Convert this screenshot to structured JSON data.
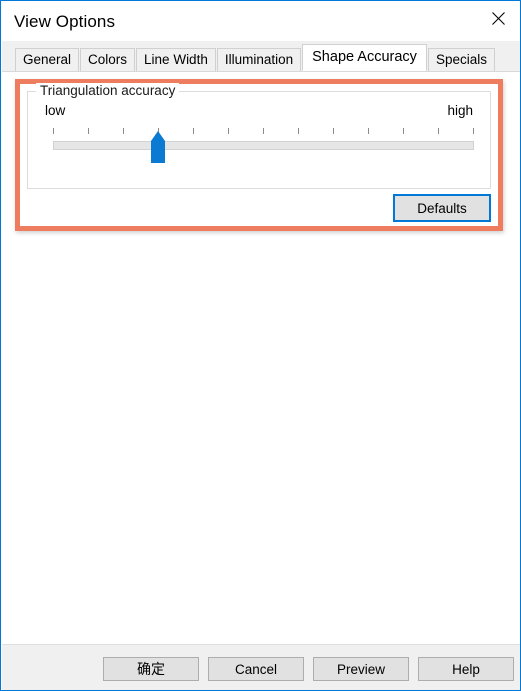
{
  "window": {
    "title": "View Options",
    "border_color": "#0078d7",
    "close_icon": "close-icon"
  },
  "tabs": [
    {
      "label": "General",
      "active": false
    },
    {
      "label": "Colors",
      "active": false
    },
    {
      "label": "Line Width",
      "active": false
    },
    {
      "label": "Illumination",
      "active": false
    },
    {
      "label": "Shape Accuracy",
      "active": true
    },
    {
      "label": "Specials",
      "active": false
    }
  ],
  "highlight": {
    "color": "#ed7d5e",
    "note": "annotation rectangle around the Triangulation accuracy group"
  },
  "group": {
    "legend": "Triangulation accuracy",
    "slider": {
      "min_label": "low",
      "max_label": "high",
      "tick_count": 13,
      "min": 0,
      "max": 12,
      "value": 3,
      "thumb_color": "#0b7ad2",
      "track_color": "#e6e6e6"
    }
  },
  "defaults_button": {
    "label": "Defaults",
    "focused": true,
    "focus_color": "#0078d7"
  },
  "footer": {
    "buttons": [
      {
        "label": "确定",
        "name": "ok-button",
        "cjk": true
      },
      {
        "label": "Cancel",
        "name": "cancel-button",
        "cjk": false
      },
      {
        "label": "Preview",
        "name": "preview-button",
        "cjk": false
      },
      {
        "label": "Help",
        "name": "help-button",
        "cjk": false
      }
    ]
  }
}
